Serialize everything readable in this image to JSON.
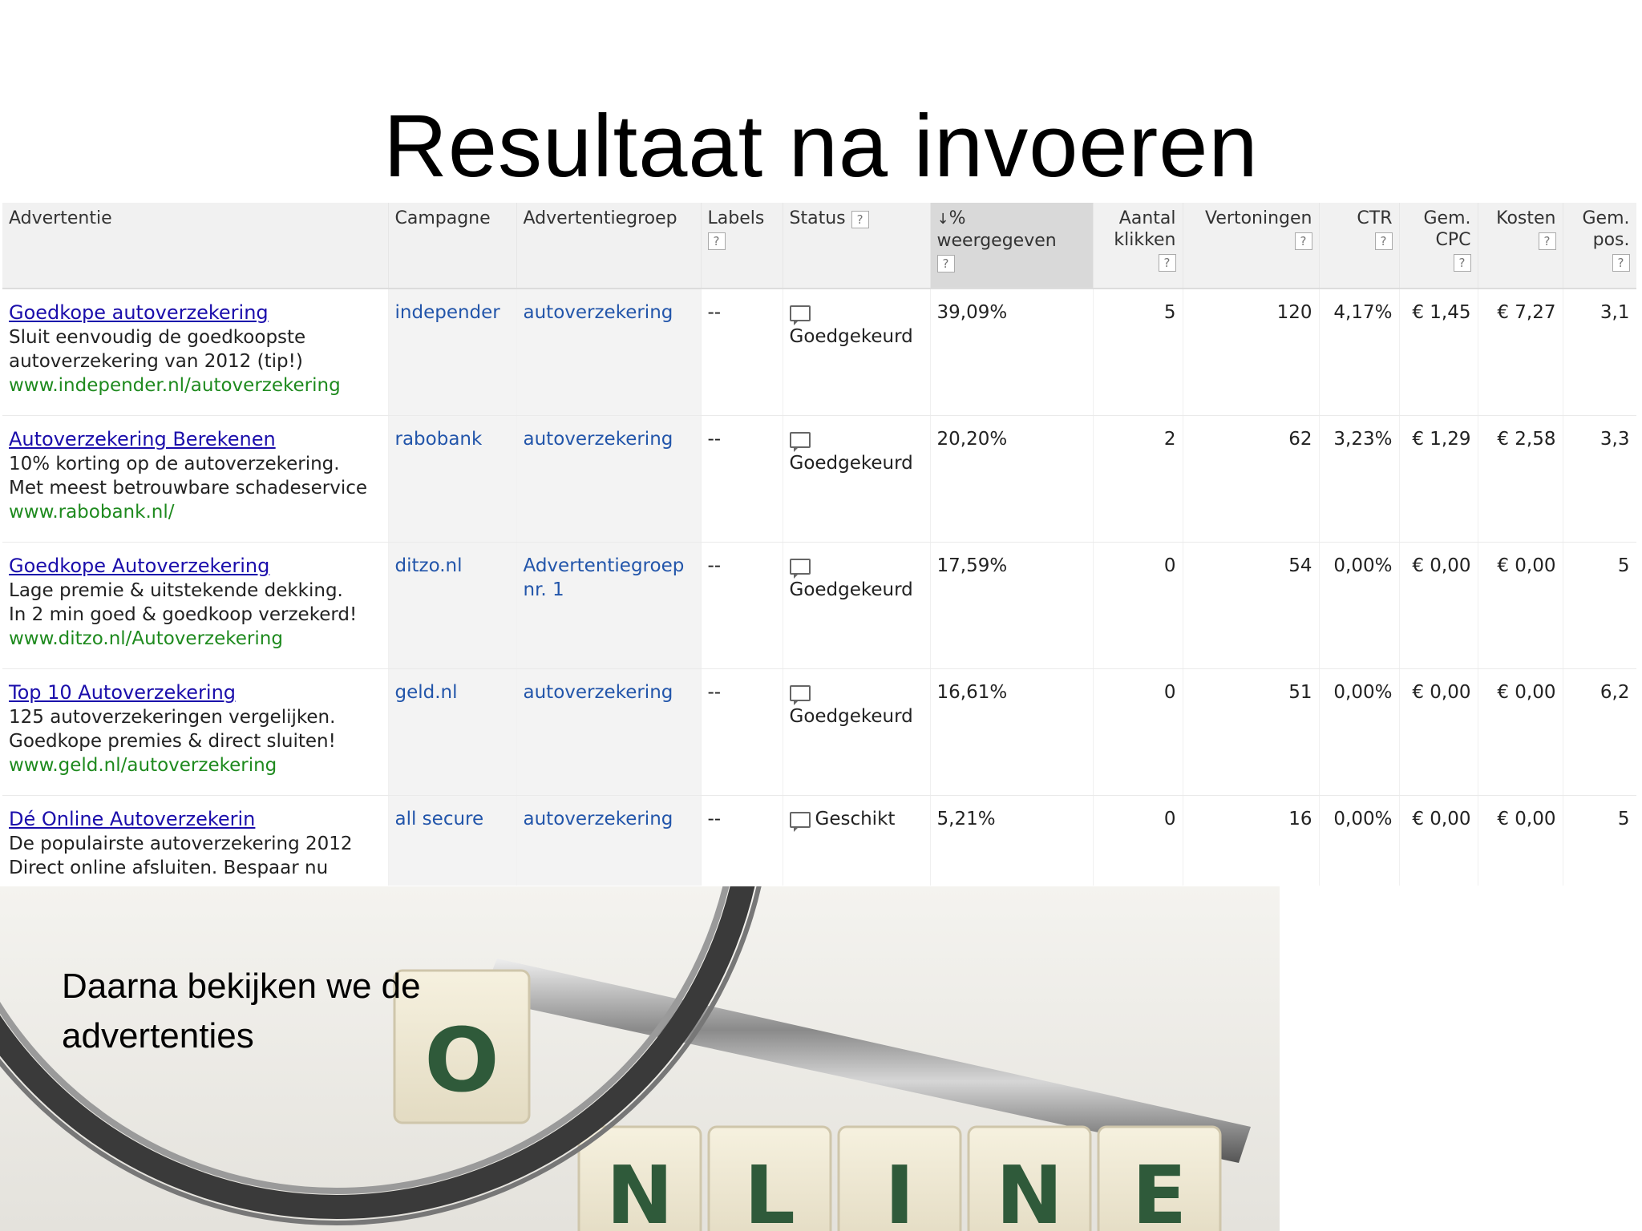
{
  "slide": {
    "title": "Resultaat na invoeren",
    "caption": "Daarna bekijken we de advertenties"
  },
  "table": {
    "headers": {
      "advertentie": "Advertentie",
      "campagne": "Campagne",
      "advertentiegroep": "Advertentiegroep",
      "labels": "Labels",
      "status": "Status",
      "pct_a": "%",
      "pct_b": "weergegeven",
      "klikken_a": "Aantal",
      "klikken_b": "klikken",
      "vertoningen": "Vertoningen",
      "ctr": "CTR",
      "cpc_a": "Gem.",
      "cpc_b": "CPC",
      "kosten": "Kosten",
      "pos_a": "Gem.",
      "pos_b": "pos.",
      "help": "?",
      "sort_arrow": "↓"
    },
    "rows": [
      {
        "ad_title": "Goedkope autoverzekering",
        "ad_line1": "Sluit eenvoudig de goedkoopste",
        "ad_line2": "autoverzekering van 2012 (tip!)",
        "ad_url": "www.independer.nl/autoverzekering",
        "campagne": "independer",
        "groep": "autoverzekering",
        "labels": "--",
        "status": "Goedgekeurd",
        "pct": "39,09%",
        "klikken": "5",
        "vertoningen": "120",
        "ctr": "4,17%",
        "cpc": "€ 1,45",
        "kosten": "€ 7,27",
        "pos": "3,1"
      },
      {
        "ad_title": "Autoverzekering Berekenen",
        "ad_line1": "10% korting op de autoverzekering.",
        "ad_line2": "Met meest betrouwbare schadeservice",
        "ad_url": "www.rabobank.nl/",
        "campagne": "rabobank",
        "groep": "autoverzekering",
        "labels": "--",
        "status": "Goedgekeurd",
        "pct": "20,20%",
        "klikken": "2",
        "vertoningen": "62",
        "ctr": "3,23%",
        "cpc": "€ 1,29",
        "kosten": "€ 2,58",
        "pos": "3,3"
      },
      {
        "ad_title": "Goedkope Autoverzekering",
        "ad_line1": "Lage premie & uitstekende dekking.",
        "ad_line2": "In 2 min goed & goedkoop verzekerd!",
        "ad_url": "www.ditzo.nl/Autoverzekering",
        "campagne": "ditzo.nl",
        "groep": "Advertentiegroep nr. 1",
        "labels": "--",
        "status": "Goedgekeurd",
        "pct": "17,59%",
        "klikken": "0",
        "vertoningen": "54",
        "ctr": "0,00%",
        "cpc": "€ 0,00",
        "kosten": "€ 0,00",
        "pos": "5"
      },
      {
        "ad_title": "Top 10 Autoverzekering",
        "ad_line1": "125 autoverzekeringen vergelijken.",
        "ad_line2": "Goedkope premies & direct sluiten!",
        "ad_url": "www.geld.nl/autoverzekering",
        "campagne": "geld.nl",
        "groep": "autoverzekering",
        "labels": "--",
        "status": "Goedgekeurd",
        "pct": "16,61%",
        "klikken": "0",
        "vertoningen": "51",
        "ctr": "0,00%",
        "cpc": "€ 0,00",
        "kosten": "€ 0,00",
        "pos": "6,2"
      },
      {
        "ad_title": "Dé Online Autoverzekerin",
        "ad_line1": "De populairste autoverzekering 2012",
        "ad_line2": "Direct online afsluiten. Bespaar nu",
        "ad_url": "",
        "campagne": "all secure",
        "groep": "autoverzekering",
        "labels": "--",
        "status": "Geschikt",
        "pct": "5,21%",
        "klikken": "0",
        "vertoningen": "16",
        "ctr": "0,00%",
        "cpc": "€ 0,00",
        "kosten": "€ 0,00",
        "pos": "5"
      }
    ]
  },
  "hero": {
    "tile_top": "O",
    "tiles": [
      "N",
      "L",
      "I",
      "N",
      "E"
    ]
  },
  "colors": {
    "ad_title": "#1a0dab",
    "ad_url": "#1e8a1e",
    "link": "#2255aa"
  }
}
